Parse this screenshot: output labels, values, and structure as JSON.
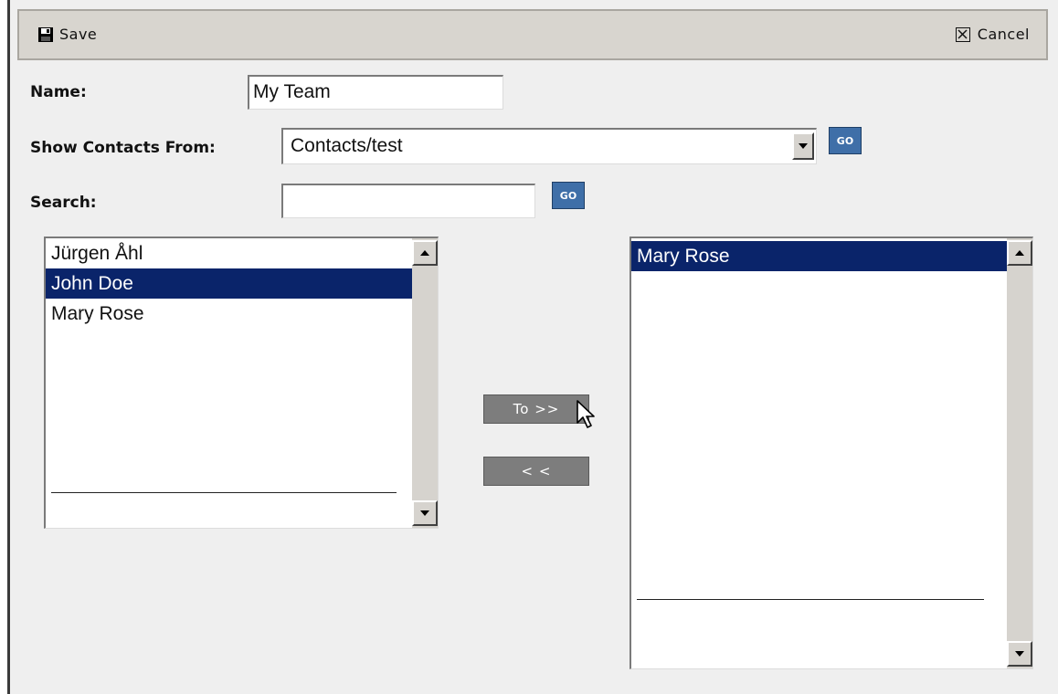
{
  "toolbar": {
    "save_label": "Save",
    "cancel_label": "Cancel"
  },
  "form": {
    "name_label": "Name:",
    "name_value": "My Team",
    "show_contacts_label": "Show Contacts From:",
    "show_contacts_value": "Contacts/test",
    "search_label": "Search:",
    "search_value": "",
    "go_label": "GO"
  },
  "available_list": {
    "items": [
      {
        "label": "Jürgen Åhl",
        "selected": false
      },
      {
        "label": "John Doe",
        "selected": true
      },
      {
        "label": "Mary Rose",
        "selected": false
      }
    ]
  },
  "selected_list": {
    "items": [
      {
        "label": "Mary Rose",
        "selected": true
      }
    ]
  },
  "actions": {
    "to_label": "To >>",
    "back_label": "< <"
  },
  "colors": {
    "selection": "#0a246a",
    "go_button": "#3f6fa8",
    "toolbar": "#d8d5cf",
    "panel": "#efefef"
  },
  "icons": {
    "save": "floppy-disk-icon",
    "cancel": "close-box-icon",
    "cursor": "mouse-pointer-icon"
  }
}
